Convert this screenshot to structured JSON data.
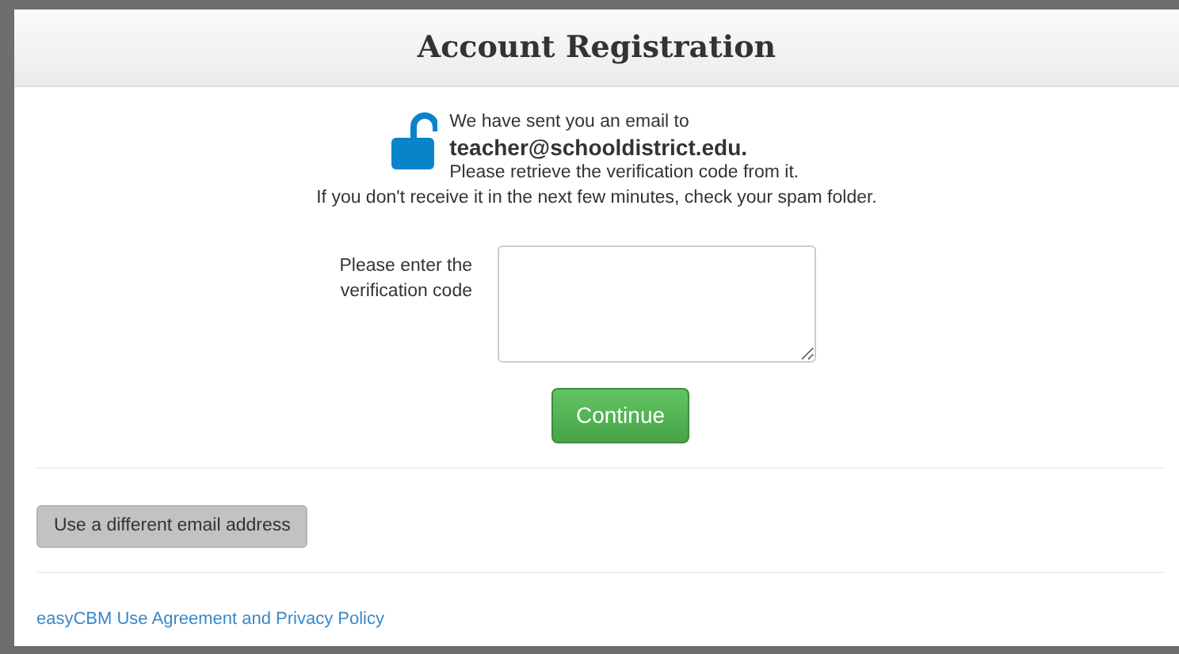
{
  "header": {
    "title": "Account Registration"
  },
  "message": {
    "line_1": "We have sent you an email to",
    "email": "teacher@schooldistrict.edu.",
    "line_2": "Please retrieve the verification code from it.",
    "line_3": "If you don't receive it in the next few minutes, check your spam folder."
  },
  "form": {
    "label": "Please enter the verification code",
    "submit": "Continue"
  },
  "secondary_button": "Use a different email address",
  "footer_link": "easyCBM Use Agreement and Privacy Policy"
}
